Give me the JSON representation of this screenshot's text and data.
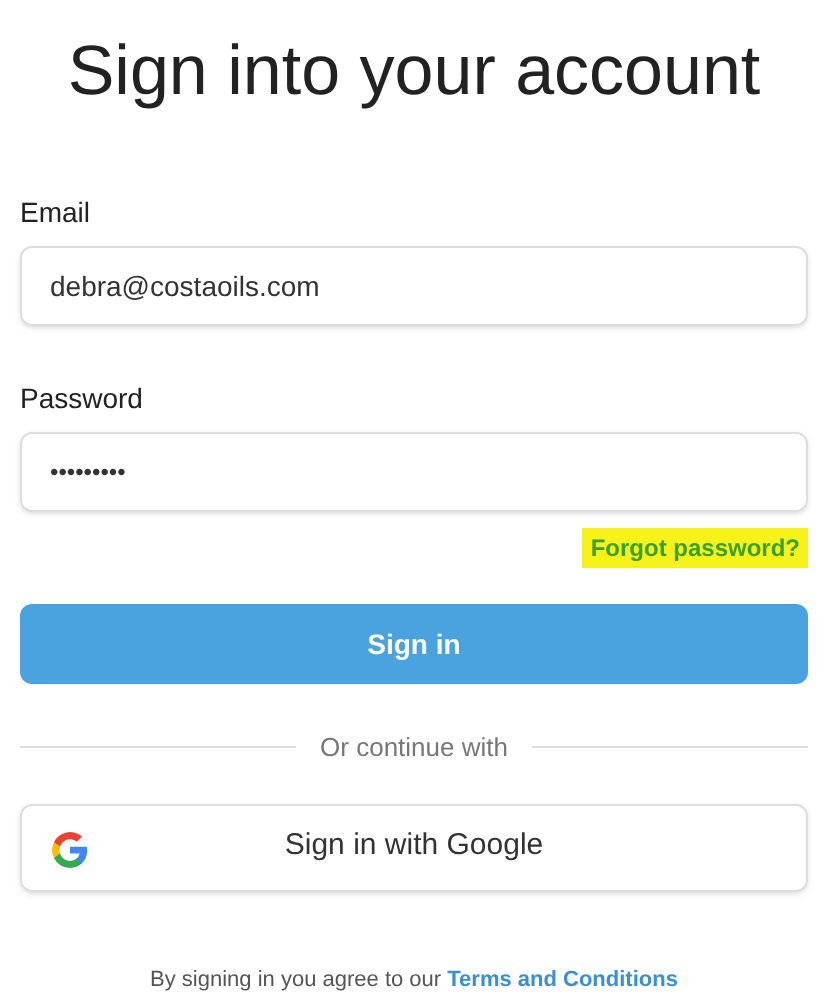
{
  "title": "Sign into your account",
  "email": {
    "label": "Email",
    "value": "debra@costaoils.com"
  },
  "password": {
    "label": "Password",
    "value": "•••••••••"
  },
  "forgot_link": {
    "label": "Forgot password?",
    "highlighted": true
  },
  "sign_in_button": "Sign in",
  "divider_text": "Or continue with",
  "google_button": "Sign in with Google",
  "footer": {
    "text": "By signing in you agree to our",
    "link": "Terms and Conditions"
  }
}
